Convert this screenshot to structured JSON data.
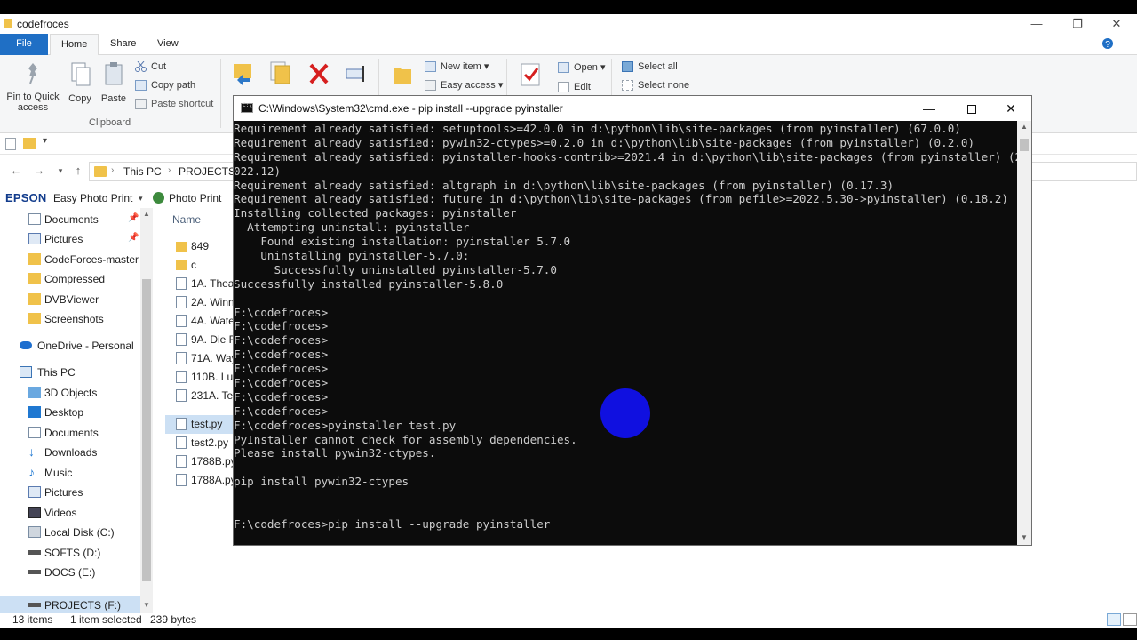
{
  "explorer": {
    "window_title": "codefroces",
    "ribbon_tabs": [
      "File",
      "Home",
      "Share",
      "View"
    ],
    "clipboard": {
      "pin_label_1": "Pin to Quick",
      "pin_label_2": "access",
      "copy": "Copy",
      "paste": "Paste",
      "cut": "Cut",
      "copy_path": "Copy path",
      "paste_shortcut": "Paste shortcut",
      "group": "Clipboard"
    },
    "new_group": {
      "new_item": "New item",
      "easy_access": "Easy access"
    },
    "open_group": {
      "open": "Open",
      "edit": "Edit"
    },
    "select_group": {
      "select_all": "Select all",
      "select_none": "Select none"
    },
    "address": {
      "crumb1": "This PC",
      "crumb2": "PROJECTS"
    },
    "favorites": {
      "brand": "EPSON",
      "easy_photo": "Easy Photo Print",
      "photo_print": "Photo Print"
    },
    "nav_items": [
      {
        "label": "Documents",
        "pinned": true
      },
      {
        "label": "Pictures",
        "pinned": true
      },
      {
        "label": "CodeForces-master"
      },
      {
        "label": "Compressed"
      },
      {
        "label": "DVBViewer"
      },
      {
        "label": "Screenshots"
      },
      {
        "label": "OneDrive - Personal"
      },
      {
        "label": "This PC"
      },
      {
        "label": "3D Objects"
      },
      {
        "label": "Desktop"
      },
      {
        "label": "Documents"
      },
      {
        "label": "Downloads"
      },
      {
        "label": "Music"
      },
      {
        "label": "Pictures"
      },
      {
        "label": "Videos"
      },
      {
        "label": "Local Disk (C:)"
      },
      {
        "label": "SOFTS (D:)"
      },
      {
        "label": "DOCS (E:)"
      },
      {
        "label": "PROJECTS (F:)"
      }
    ],
    "column_name": "Name",
    "files": [
      "849",
      "c",
      "1A. Thea",
      "2A. Winn",
      "4A. Wate",
      "9A. Die R",
      "71A. Way",
      "110B. Lu",
      "231A. Te",
      "test.py",
      "test2.py",
      "1788B.py",
      "1788A.py"
    ],
    "status": {
      "items": "13 items",
      "selected": "1 item selected",
      "size": "239 bytes"
    }
  },
  "cmd": {
    "title": "C:\\Windows\\System32\\cmd.exe - pip  install --upgrade pyinstaller",
    "lines": [
      "Requirement already satisfied: setuptools>=42.0.0 in d:\\python\\lib\\site-packages (from pyinstaller) (67.0.0)",
      "Requirement already satisfied: pywin32-ctypes>=0.2.0 in d:\\python\\lib\\site-packages (from pyinstaller) (0.2.0)",
      "Requirement already satisfied: pyinstaller-hooks-contrib>=2021.4 in d:\\python\\lib\\site-packages (from pyinstaller) (2",
      "022.12)",
      "Requirement already satisfied: altgraph in d:\\python\\lib\\site-packages (from pyinstaller) (0.17.3)",
      "Requirement already satisfied: future in d:\\python\\lib\\site-packages (from pefile>=2022.5.30->pyinstaller) (0.18.2)",
      "Installing collected packages: pyinstaller",
      "  Attempting uninstall: pyinstaller",
      "    Found existing installation: pyinstaller 5.7.0",
      "    Uninstalling pyinstaller-5.7.0:",
      "      Successfully uninstalled pyinstaller-5.7.0",
      "Successfully installed pyinstaller-5.8.0",
      "",
      "F:\\codefroces>",
      "F:\\codefroces>",
      "F:\\codefroces>",
      "F:\\codefroces>",
      "F:\\codefroces>",
      "F:\\codefroces>",
      "F:\\codefroces>",
      "F:\\codefroces>",
      "F:\\codefroces>pyinstaller test.py",
      "PyInstaller cannot check for assembly dependencies.",
      "Please install pywin32-ctypes.",
      "",
      "pip install pywin32-ctypes",
      "",
      "",
      "F:\\codefroces>pip install --upgrade pyinstaller"
    ]
  },
  "colors": {
    "accent": "#1f6fc5",
    "console_bg": "#0c0c0c",
    "console_fg": "#cccccc",
    "cursor_highlight": "#1010e0",
    "folder": "#f0c24a"
  }
}
